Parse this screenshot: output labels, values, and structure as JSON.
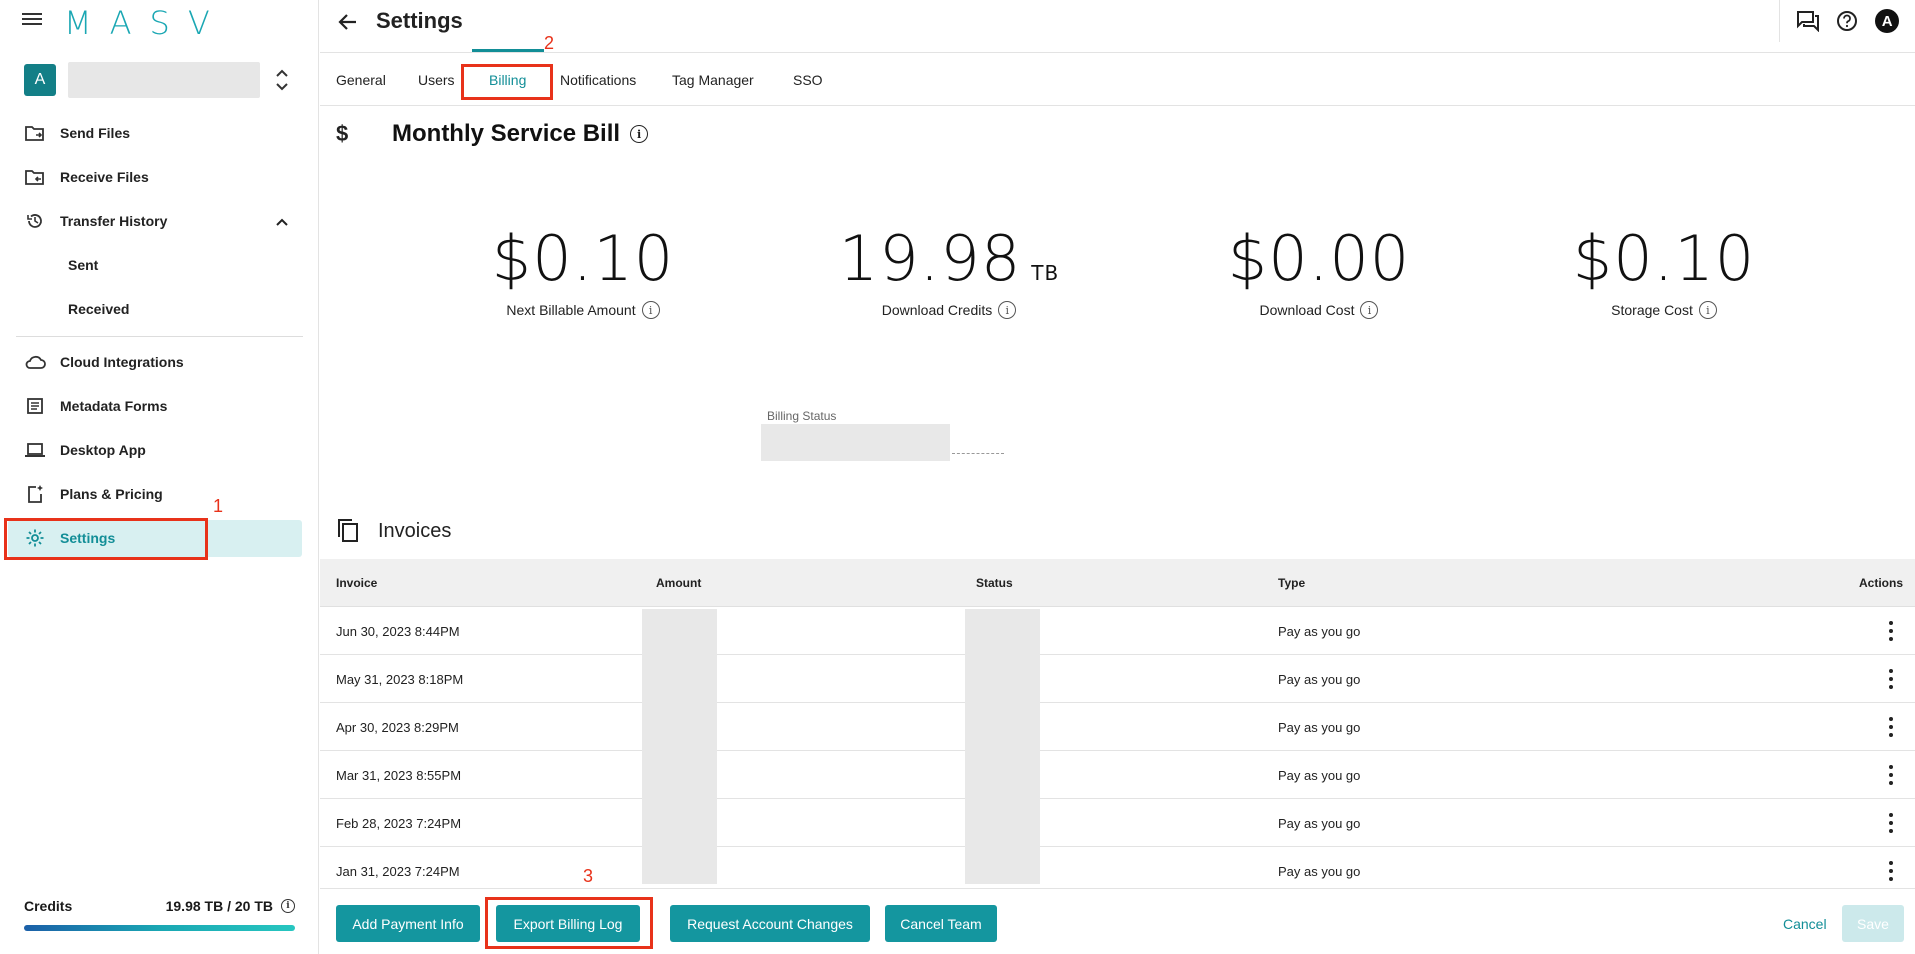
{
  "app": {
    "logo": "MASV"
  },
  "team": {
    "avatar_letter": "A"
  },
  "sidebar": {
    "items": [
      {
        "label": "Send Files"
      },
      {
        "label": "Receive Files"
      },
      {
        "label": "Transfer History"
      },
      {
        "label": "Sent"
      },
      {
        "label": "Received"
      },
      {
        "label": "Cloud Integrations"
      },
      {
        "label": "Metadata Forms"
      },
      {
        "label": "Desktop App"
      },
      {
        "label": "Plans & Pricing"
      },
      {
        "label": "Settings"
      }
    ],
    "credits_label": "Credits",
    "credits_value": "19.98 TB / 20 TB",
    "credits_fraction": 0.999
  },
  "header": {
    "title": "Settings",
    "avatar_letter": "A"
  },
  "tabs": [
    {
      "label": "General"
    },
    {
      "label": "Users"
    },
    {
      "label": "Billing"
    },
    {
      "label": "Notifications"
    },
    {
      "label": "Tag Manager"
    },
    {
      "label": "SSO"
    }
  ],
  "annotations": {
    "one": "1",
    "two": "2",
    "three": "3"
  },
  "bill": {
    "title": "Monthly Service Bill",
    "stats": [
      {
        "value": "$0.10",
        "unit": "",
        "label": "Next Billable Amount"
      },
      {
        "value": "19.98",
        "unit": "TB",
        "label": "Download Credits"
      },
      {
        "value": "$0.00",
        "unit": "",
        "label": "Download Cost"
      },
      {
        "value": "$0.10",
        "unit": "",
        "label": "Storage Cost"
      }
    ],
    "billing_status_label": "Billing Status"
  },
  "invoices": {
    "title": "Invoices",
    "columns": [
      "Invoice",
      "Amount",
      "Status",
      "Type",
      "Actions"
    ],
    "rows": [
      {
        "invoice": "Jun 30, 2023 8:44PM",
        "type": "Pay as you go"
      },
      {
        "invoice": "May 31, 2023 8:18PM",
        "type": "Pay as you go"
      },
      {
        "invoice": "Apr 30, 2023 8:29PM",
        "type": "Pay as you go"
      },
      {
        "invoice": "Mar 31, 2023 8:55PM",
        "type": "Pay as you go"
      },
      {
        "invoice": "Feb 28, 2023 7:24PM",
        "type": "Pay as you go"
      },
      {
        "invoice": "Jan 31, 2023 7:24PM",
        "type": "Pay as you go"
      }
    ]
  },
  "footer": {
    "add_payment": "Add Payment Info",
    "export_log": "Export Billing Log",
    "request_changes": "Request Account Changes",
    "cancel_team": "Cancel Team",
    "cancel": "Cancel",
    "save": "Save"
  }
}
